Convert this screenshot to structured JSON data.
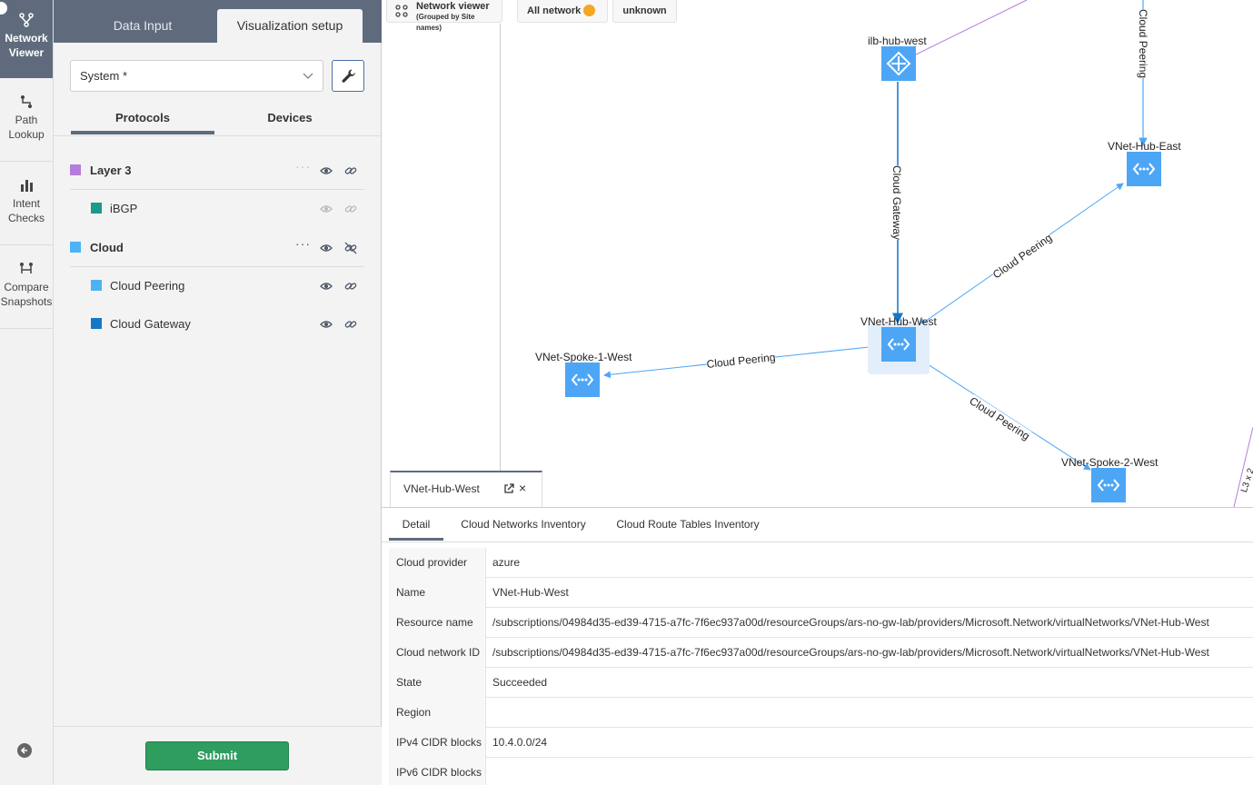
{
  "rail": {
    "items": [
      {
        "label1": "Network",
        "label2": "Viewer"
      },
      {
        "label1": "Path",
        "label2": "Lookup"
      },
      {
        "label1": "Intent",
        "label2": "Checks"
      },
      {
        "label1": "Compare",
        "label2": "Snapshots"
      }
    ]
  },
  "panel": {
    "tabs": [
      "Data Input",
      "Visualization setup"
    ],
    "system_select": "System *",
    "subtabs": [
      "Protocols",
      "Devices"
    ],
    "protocols": [
      {
        "label": "Layer 3",
        "color": "#b57edc"
      },
      {
        "label": "iBGP",
        "color": "#1a9a8a"
      },
      {
        "label": "Cloud",
        "color": "#4db3f5"
      },
      {
        "label": "Cloud Peering",
        "color": "#4db3f5"
      },
      {
        "label": "Cloud Gateway",
        "color": "#1477c8"
      }
    ],
    "dots": "···",
    "submit": "Submit"
  },
  "canvas": {
    "chip_title": "Network viewer",
    "chip_sub": "(Grouped by Site names)",
    "chip_all": "All network",
    "chip_unknown": "unknown",
    "nodes": {
      "ilb": "ilb-hub-west",
      "hub_east": "VNet-Hub-East",
      "hub_west": "VNet-Hub-West",
      "spoke1": "VNet-Spoke-1-West",
      "spoke2": "VNet-Spoke-2-West"
    },
    "edges": {
      "cloud_peering": "Cloud Peering",
      "cloud_gateway": "Cloud Gateway",
      "l3_partial": "L3 x 2"
    }
  },
  "detail": {
    "tab_title": "VNet-Hub-West",
    "subtabs": [
      "Detail",
      "Cloud Networks Inventory",
      "Cloud Route Tables Inventory"
    ],
    "rows": [
      {
        "key": "Cloud provider",
        "value": "azure"
      },
      {
        "key": "Name",
        "value": "VNet-Hub-West"
      },
      {
        "key": "Resource name",
        "value": "/subscriptions/04984d35-ed39-4715-a7fc-7f6ec937a00d/resourceGroups/ars-no-gw-lab/providers/Microsoft.Network/virtualNetworks/VNet-Hub-West"
      },
      {
        "key": "Cloud network ID",
        "value": "/subscriptions/04984d35-ed39-4715-a7fc-7f6ec937a00d/resourceGroups/ars-no-gw-lab/providers/Microsoft.Network/virtualNetworks/VNet-Hub-West"
      },
      {
        "key": "State",
        "value": "Succeeded"
      },
      {
        "key": "Region",
        "value": ""
      },
      {
        "key": "IPv4 CIDR blocks",
        "value": "10.4.0.0/24"
      },
      {
        "key": "IPv6 CIDR blocks",
        "value": ""
      }
    ]
  }
}
